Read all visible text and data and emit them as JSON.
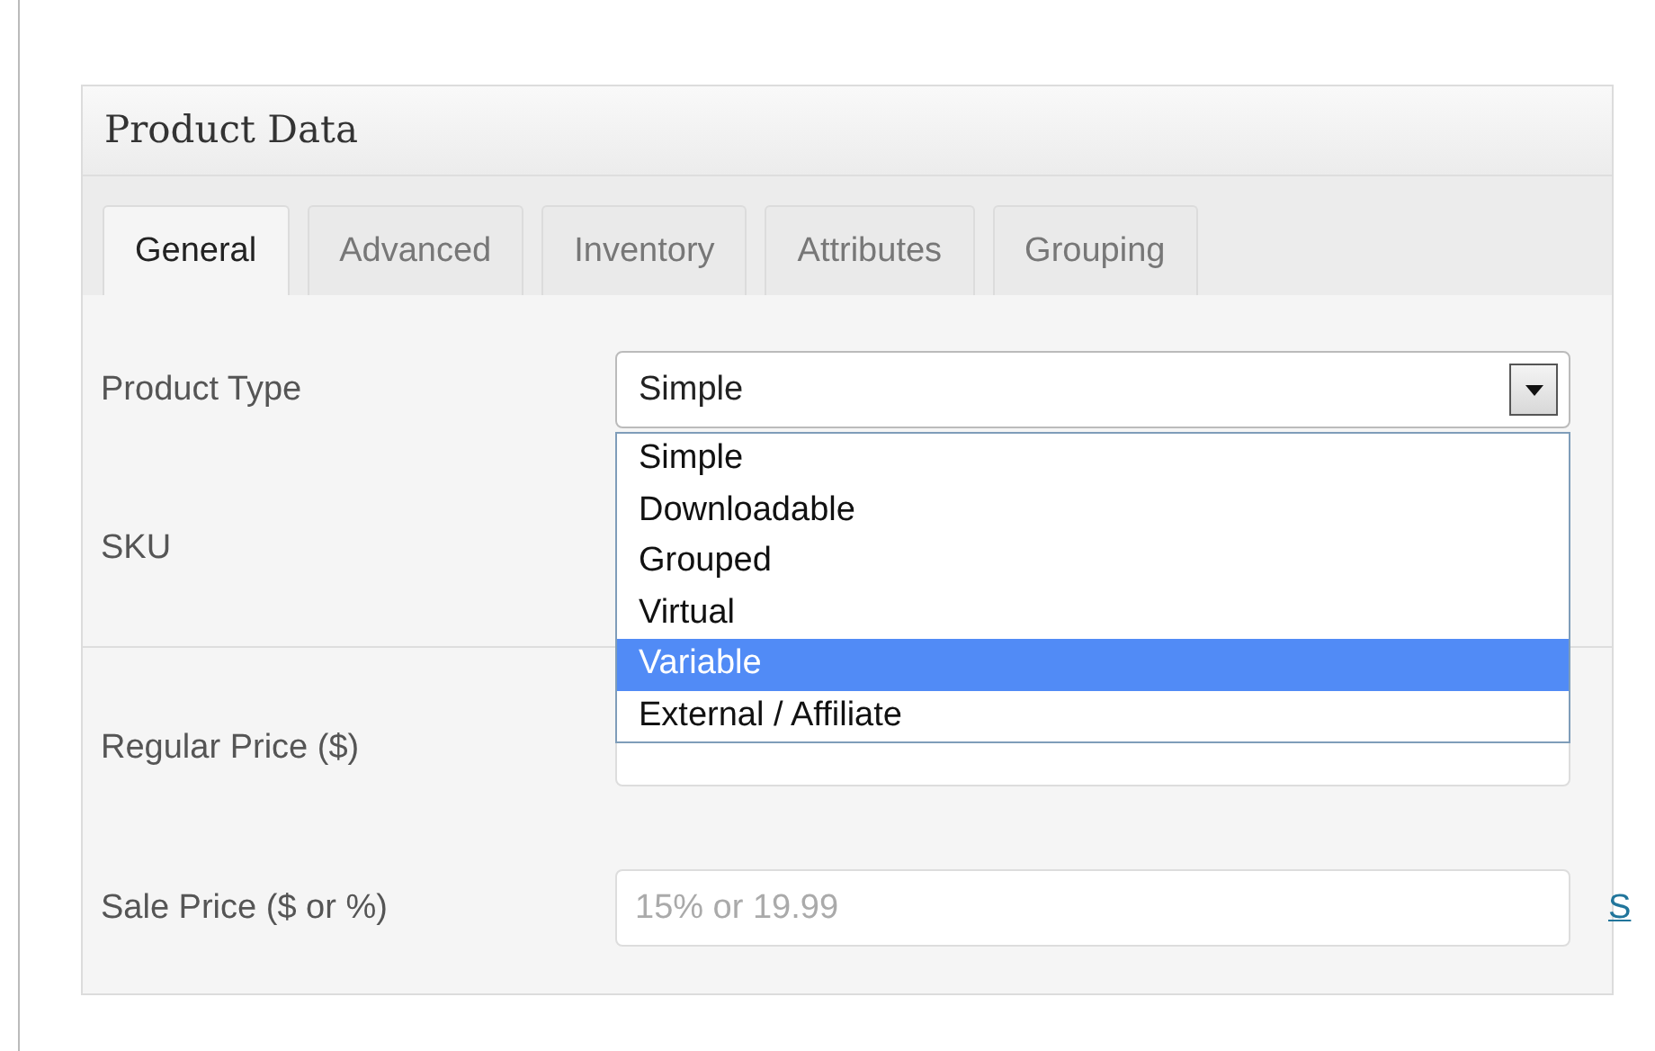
{
  "panel": {
    "title": "Product Data"
  },
  "tabs": [
    {
      "label": "General",
      "selected": true
    },
    {
      "label": "Advanced",
      "selected": false
    },
    {
      "label": "Inventory",
      "selected": false
    },
    {
      "label": "Attributes",
      "selected": false
    },
    {
      "label": "Grouping",
      "selected": false
    }
  ],
  "sections": [
    {
      "fields": [
        {
          "kind": "select",
          "label": "Product Type",
          "value": "Simple",
          "expanded": true,
          "options": [
            {
              "label": "Simple",
              "highlighted": false
            },
            {
              "label": "Downloadable",
              "highlighted": false
            },
            {
              "label": "Grouped",
              "highlighted": false
            },
            {
              "label": "Virtual",
              "highlighted": false
            },
            {
              "label": "Variable",
              "highlighted": true
            },
            {
              "label": "External / Affiliate",
              "highlighted": false
            }
          ]
        },
        {
          "kind": "label",
          "label": "SKU"
        }
      ]
    },
    {
      "fields": [
        {
          "kind": "text",
          "label": "Regular Price ($)"
        },
        {
          "kind": "text",
          "label": "Sale Price ($ or %)",
          "placeholder": "15% or 19.99",
          "link": "S"
        }
      ]
    }
  ]
}
